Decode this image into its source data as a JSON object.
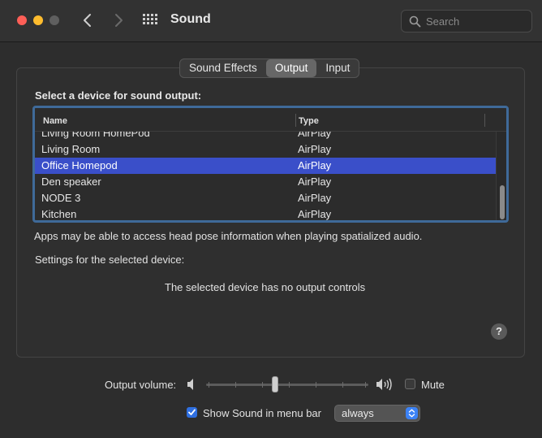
{
  "window": {
    "title": "Sound"
  },
  "search": {
    "placeholder": "Search"
  },
  "tabs": [
    {
      "label": "Sound Effects",
      "active": false
    },
    {
      "label": "Output",
      "active": true
    },
    {
      "label": "Input",
      "active": false
    }
  ],
  "output": {
    "select_label": "Select a device for sound output:",
    "columns": {
      "name": "Name",
      "type": "Type"
    },
    "devices": [
      {
        "name": "Living Room HomePod",
        "type": "AirPlay"
      },
      {
        "name": "Living Room",
        "type": "AirPlay"
      },
      {
        "name": "Office Homepod",
        "type": "AirPlay",
        "selected": true
      },
      {
        "name": "Den speaker",
        "type": "AirPlay"
      },
      {
        "name": "NODE 3",
        "type": "AirPlay"
      },
      {
        "name": "Kitchen",
        "type": "AirPlay"
      }
    ],
    "head_pose_note": "Apps may be able to access head pose information when playing spatialized audio.",
    "settings_label": "Settings for the selected device:",
    "no_controls_text": "The selected device has no output controls"
  },
  "help": {
    "label": "?"
  },
  "volume": {
    "label": "Output volume:",
    "level": 0.42,
    "mute_label": "Mute",
    "muted": false
  },
  "menubar": {
    "show_label": "Show Sound in menu bar",
    "checked": true,
    "option": "always"
  },
  "colors": {
    "selection": "#3a4fc9",
    "accent": "#2f6fe0",
    "table_border": "#3f6a99"
  }
}
